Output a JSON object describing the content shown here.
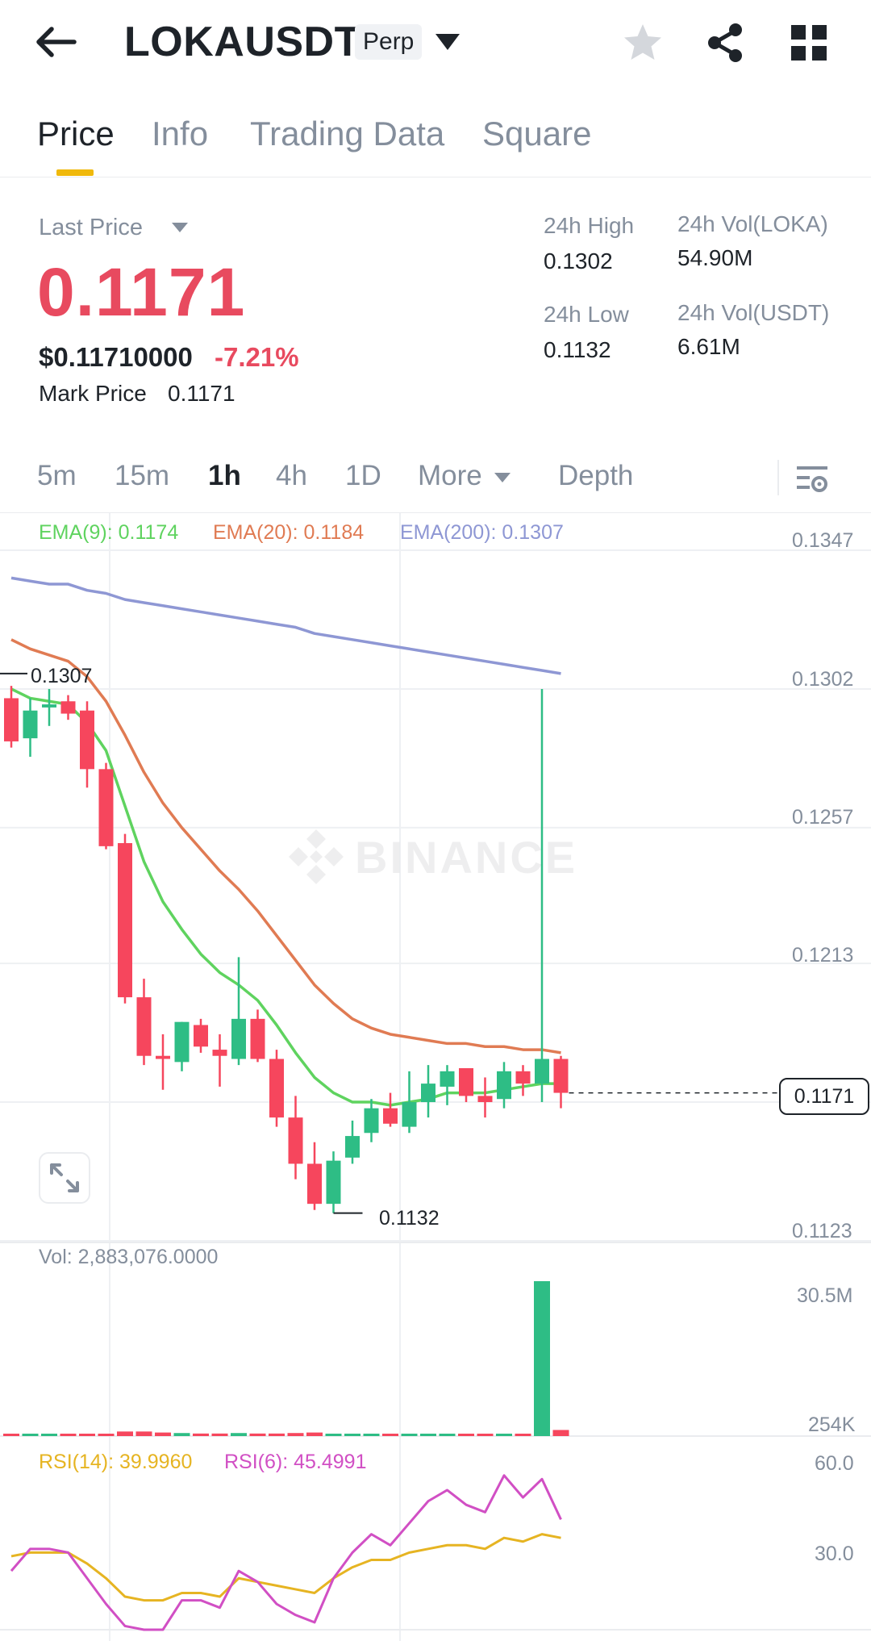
{
  "header": {
    "symbol": "LOKAUSDT",
    "contract_type": "Perp",
    "icons": [
      "back-arrow-icon",
      "chevron-down-icon",
      "star-icon",
      "share-icon",
      "grid-icon"
    ]
  },
  "tabs": [
    {
      "label": "Price",
      "active": true
    },
    {
      "label": "Info",
      "active": false
    },
    {
      "label": "Trading Data",
      "active": false
    },
    {
      "label": "Square",
      "active": false
    }
  ],
  "price": {
    "last_price_label": "Last Price",
    "last_price": "0.1171",
    "usd_price": "$0.11710000",
    "change": "-7.21%",
    "mark_price_label": "Mark Price",
    "mark_price": "0.1171"
  },
  "stats": {
    "high_label": "24h High",
    "high": "0.1302",
    "low_label": "24h Low",
    "low": "0.1132",
    "vol_base_label": "24h Vol(LOKA)",
    "vol_base": "54.90M",
    "vol_quote_label": "24h Vol(USDT)",
    "vol_quote": "6.61M"
  },
  "intervals": [
    {
      "label": "5m",
      "active": false
    },
    {
      "label": "15m",
      "active": false
    },
    {
      "label": "1h",
      "active": true
    },
    {
      "label": "4h",
      "active": false
    },
    {
      "label": "1D",
      "active": false
    },
    {
      "label": "More",
      "active": false
    },
    {
      "label": "Depth",
      "active": false
    }
  ],
  "chart": {
    "ema9_label": "EMA(9): 0.1174",
    "ema20_label": "EMA(20): 0.1184",
    "ema200_label": "EMA(200): 0.1307",
    "price_axis": [
      "0.1347",
      "0.1302",
      "0.1257",
      "0.1213",
      "0.1123"
    ],
    "current_price_tag": "0.1171",
    "max_marker": "0.1307",
    "min_marker": "0.1132",
    "watermark": "BINANCE",
    "vol_label": "Vol: 2,883,076.0000",
    "vol_axis": [
      "30.5M",
      "254K"
    ],
    "rsi14_label": "RSI(14): 39.9960",
    "rsi6_label": "RSI(6): 45.4991",
    "rsi_axis": [
      "60.0",
      "30.0"
    ],
    "colors": {
      "up": "#2ebd85",
      "down": "#f6465d",
      "ema9": "#5fd35f",
      "ema20": "#e07b53",
      "ema200": "#8e97d4",
      "rsi14": "#e6b422",
      "rsi6": "#d14fc4"
    }
  },
  "chart_data": {
    "type": "candlestick",
    "interval": "1h",
    "ylim": [
      0.1123,
      0.1347
    ],
    "candles": [
      {
        "open": 0.1299,
        "high": 0.1303,
        "low": 0.1283,
        "close": 0.1285
      },
      {
        "open": 0.1286,
        "high": 0.1299,
        "low": 0.128,
        "close": 0.1295
      },
      {
        "open": 0.1296,
        "high": 0.1302,
        "low": 0.129,
        "close": 0.1297
      },
      {
        "open": 0.1298,
        "high": 0.13,
        "low": 0.1292,
        "close": 0.1294
      },
      {
        "open": 0.1295,
        "high": 0.1298,
        "low": 0.127,
        "close": 0.1276
      },
      {
        "open": 0.1276,
        "high": 0.1278,
        "low": 0.125,
        "close": 0.1251
      },
      {
        "open": 0.1252,
        "high": 0.1255,
        "low": 0.12,
        "close": 0.1202
      },
      {
        "open": 0.1202,
        "high": 0.1208,
        "low": 0.118,
        "close": 0.1183
      },
      {
        "open": 0.1183,
        "high": 0.119,
        "low": 0.1172,
        "close": 0.1182
      },
      {
        "open": 0.1181,
        "high": 0.1194,
        "low": 0.1178,
        "close": 0.1194
      },
      {
        "open": 0.1193,
        "high": 0.1195,
        "low": 0.1184,
        "close": 0.1186
      },
      {
        "open": 0.1185,
        "high": 0.119,
        "low": 0.1173,
        "close": 0.1183
      },
      {
        "open": 0.1182,
        "high": 0.1215,
        "low": 0.118,
        "close": 0.1195
      },
      {
        "open": 0.1195,
        "high": 0.1198,
        "low": 0.1181,
        "close": 0.1182
      },
      {
        "open": 0.1182,
        "high": 0.1185,
        "low": 0.116,
        "close": 0.1163
      },
      {
        "open": 0.1163,
        "high": 0.117,
        "low": 0.1143,
        "close": 0.1148
      },
      {
        "open": 0.1148,
        "high": 0.1155,
        "low": 0.1133,
        "close": 0.1135
      },
      {
        "open": 0.1135,
        "high": 0.1152,
        "low": 0.1132,
        "close": 0.1149
      },
      {
        "open": 0.115,
        "high": 0.1162,
        "low": 0.1148,
        "close": 0.1157
      },
      {
        "open": 0.1158,
        "high": 0.1169,
        "low": 0.1155,
        "close": 0.1166
      },
      {
        "open": 0.1166,
        "high": 0.1171,
        "low": 0.116,
        "close": 0.1161
      },
      {
        "open": 0.116,
        "high": 0.1178,
        "low": 0.1158,
        "close": 0.1168
      },
      {
        "open": 0.1168,
        "high": 0.118,
        "low": 0.1163,
        "close": 0.1174
      },
      {
        "open": 0.1173,
        "high": 0.118,
        "low": 0.1167,
        "close": 0.1178
      },
      {
        "open": 0.1179,
        "high": 0.1179,
        "low": 0.1168,
        "close": 0.117
      },
      {
        "open": 0.117,
        "high": 0.1176,
        "low": 0.1163,
        "close": 0.1168
      },
      {
        "open": 0.1169,
        "high": 0.1181,
        "low": 0.1166,
        "close": 0.1178
      },
      {
        "open": 0.1178,
        "high": 0.118,
        "low": 0.117,
        "close": 0.1174
      },
      {
        "open": 0.1174,
        "high": 0.1302,
        "low": 0.1168,
        "close": 0.1182
      },
      {
        "open": 0.1182,
        "high": 0.1183,
        "low": 0.1166,
        "close": 0.1171
      }
    ],
    "volumes": [
      0.3,
      0.1,
      0.1,
      0.1,
      0.1,
      0.4,
      0.9,
      0.9,
      0.7,
      0.6,
      0.5,
      0.5,
      0.6,
      0.5,
      0.5,
      0.6,
      0.7,
      0.3,
      0.3,
      0.3,
      0.2,
      0.2,
      0.1,
      0.1,
      0.1,
      0.2,
      0.1,
      0.1,
      30.5,
      1.2
    ],
    "ema9": [
      0.1302,
      0.1299,
      0.1298,
      0.1297,
      0.1291,
      0.1282,
      0.1264,
      0.1246,
      0.1233,
      0.1224,
      0.1216,
      0.121,
      0.1206,
      0.1201,
      0.1193,
      0.1184,
      0.1176,
      0.1171,
      0.1168,
      0.1168,
      0.1167,
      0.1168,
      0.1169,
      0.1171,
      0.1171,
      0.1171,
      0.1172,
      0.1173,
      0.1174,
      0.1174
    ],
    "ema20": [
      0.1318,
      0.1315,
      0.1313,
      0.1311,
      0.1306,
      0.1298,
      0.1287,
      0.1275,
      0.1265,
      0.1257,
      0.125,
      0.1243,
      0.1237,
      0.123,
      0.1222,
      0.1214,
      0.1206,
      0.12,
      0.1195,
      0.1192,
      0.119,
      0.1189,
      0.1188,
      0.1187,
      0.1187,
      0.1186,
      0.1186,
      0.1185,
      0.1185,
      0.1184
    ],
    "ema200": [
      0.1338,
      0.1337,
      0.1336,
      0.1336,
      0.1334,
      0.1333,
      0.1331,
      0.133,
      0.1329,
      0.1328,
      0.1327,
      0.1326,
      0.1325,
      0.1324,
      0.1323,
      0.1322,
      0.132,
      0.1319,
      0.1318,
      0.1317,
      0.1316,
      0.1315,
      0.1314,
      0.1313,
      0.1312,
      0.1311,
      0.131,
      0.1309,
      0.1308,
      0.1307
    ],
    "rsi14": [
      35,
      36,
      36,
      36,
      33,
      29,
      24,
      23,
      23,
      25,
      25,
      24,
      29,
      28,
      27,
      26,
      25,
      29,
      32,
      34,
      34,
      36,
      37,
      38,
      38,
      37,
      40,
      39,
      41,
      40
    ],
    "rsi6": [
      31,
      37,
      37,
      36,
      29,
      22,
      16,
      15,
      15,
      23,
      23,
      21,
      31,
      28,
      22,
      19,
      17,
      29,
      36,
      41,
      38,
      44,
      50,
      53,
      49,
      47,
      57,
      51,
      56,
      45
    ],
    "rsi_range": [
      15,
      62
    ]
  }
}
